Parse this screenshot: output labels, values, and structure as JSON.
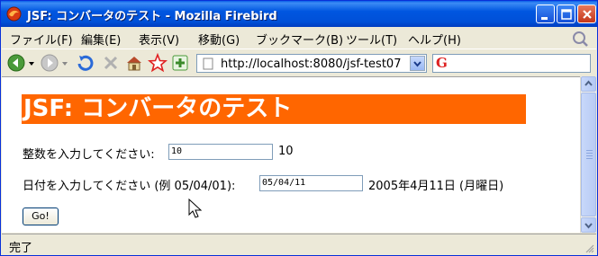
{
  "window": {
    "title": "JSF: コンバータのテスト - Mozilla Firebird"
  },
  "menu": {
    "items": [
      "ファイル(F)",
      "編集(E)",
      "表示(V)",
      "移動(G)",
      "ブックマーク(B)",
      "ツール(T)",
      "ヘルプ(H)"
    ]
  },
  "toolbar": {
    "url": "http://localhost:8080/jsf-test07",
    "search_engine_icon": "google-icon"
  },
  "page": {
    "heading": "JSF: コンバータのテスト",
    "integer_label": "整数を入力してください:",
    "integer_value": "10",
    "integer_output": "10",
    "date_label": "日付を入力してください (例 05/04/01):",
    "date_value": "05/04/11",
    "date_output": "2005年4月11日 (月曜日)",
    "go_label": "Go!"
  },
  "status": {
    "text": "完了"
  },
  "colors": {
    "heading_bg": "#ff6600",
    "titlebar": "#0054e3"
  }
}
